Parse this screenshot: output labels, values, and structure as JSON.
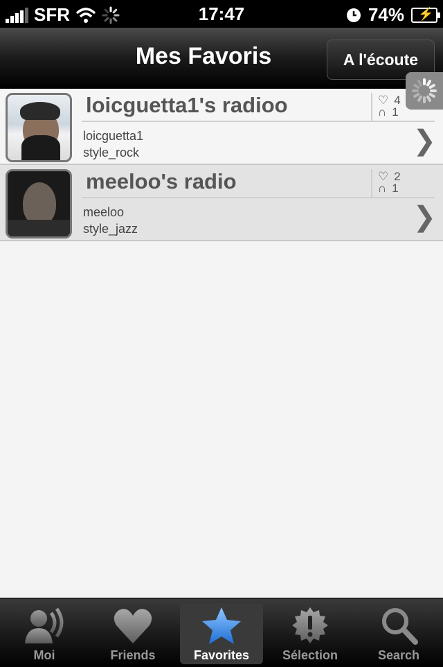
{
  "status": {
    "carrier": "SFR",
    "time": "17:47",
    "battery": "74%"
  },
  "nav": {
    "title": "Mes Favoris",
    "right_button": "A l'écoute"
  },
  "rows": [
    {
      "name": "loicguetta1's radioo",
      "user": "loicguetta1",
      "style": "style_rock",
      "likes": "4",
      "listeners": "1"
    },
    {
      "name": "meeloo's radio",
      "user": "meeloo",
      "style": "style_jazz",
      "likes": "2",
      "listeners": "1"
    }
  ],
  "tabs": [
    {
      "label": "Moi",
      "icon": "user-speaker-icon"
    },
    {
      "label": "Friends",
      "icon": "heart-icon"
    },
    {
      "label": "Favorites",
      "icon": "star-icon",
      "selected": true
    },
    {
      "label": "Sélection",
      "icon": "badge-exclamation-icon"
    },
    {
      "label": "Search",
      "icon": "search-icon"
    }
  ],
  "colors": {
    "accent_star": "#3a8fe8",
    "nav_bg": "#1a1a1a"
  }
}
